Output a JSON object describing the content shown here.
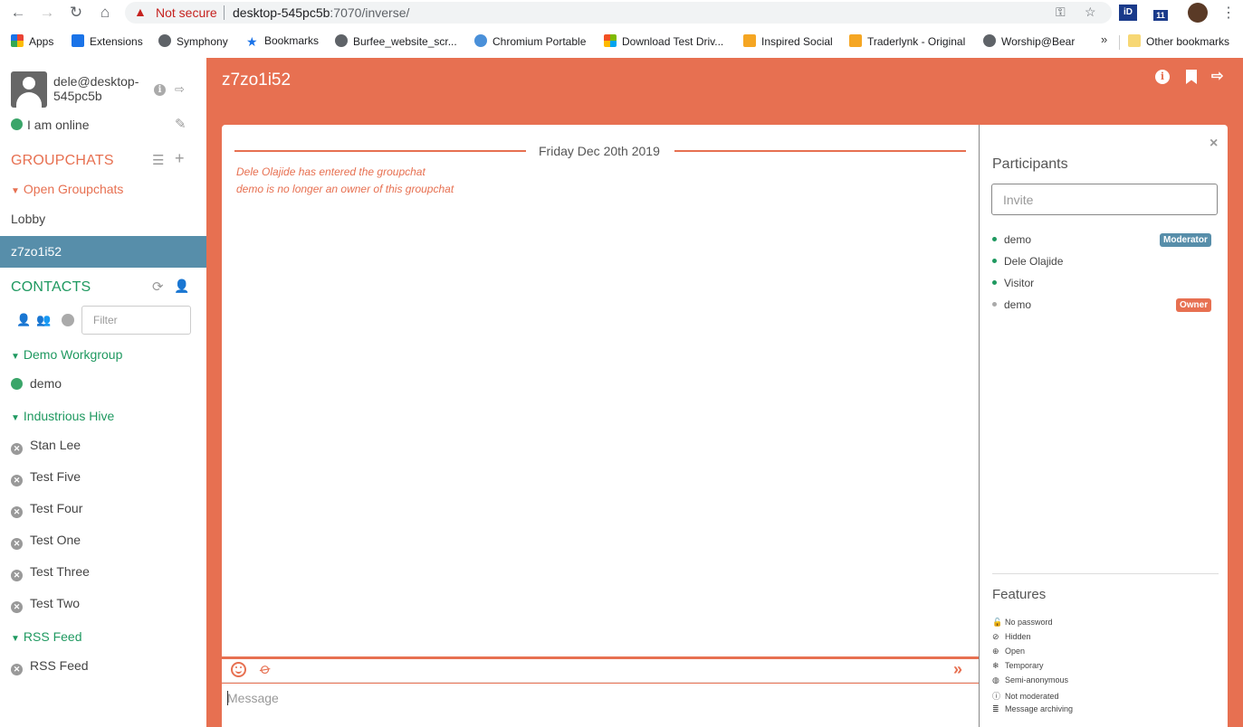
{
  "browser": {
    "not_secure": "Not secure",
    "url_host": "desktop-545pc5b",
    "url_path": ":7070/inverse/",
    "ext_badge": "11",
    "bookmarks": [
      {
        "label": "Apps",
        "color": "#ea4335"
      },
      {
        "label": "Extensions",
        "color": "#1a73e8"
      },
      {
        "label": "Symphony",
        "color": "#5f6368"
      },
      {
        "label": "Bookmarks",
        "color": "#1a73e8"
      },
      {
        "label": "Burfee_website_scr...",
        "color": "#5f6368"
      },
      {
        "label": "Chromium Portable",
        "color": "#4a90d9"
      },
      {
        "label": "Download Test Driv...",
        "color": "#f25022"
      },
      {
        "label": "Inspired Social",
        "color": "#f5a623"
      },
      {
        "label": "Traderlynk - Original",
        "color": "#f5a623"
      },
      {
        "label": "Worship@Bear",
        "color": "#5f6368"
      }
    ],
    "other_bookmarks": "Other bookmarks"
  },
  "sidebar": {
    "username": "dele@desktop-545pc5b",
    "status": "I am online",
    "groupchats_title": "GROUPCHATS",
    "open_groupchats": "Open Groupchats",
    "rooms": [
      {
        "name": "Lobby"
      },
      {
        "name": "z7zo1i52"
      }
    ],
    "contacts_title": "CONTACTS",
    "filter_placeholder": "Filter",
    "groups": [
      {
        "name": "Demo Workgroup",
        "contacts": [
          {
            "name": "demo",
            "online": true
          }
        ]
      },
      {
        "name": "Industrious Hive",
        "contacts": [
          {
            "name": "Stan Lee"
          },
          {
            "name": "Test Five"
          },
          {
            "name": "Test Four"
          },
          {
            "name": "Test One"
          },
          {
            "name": "Test Three"
          },
          {
            "name": "Test Two"
          }
        ]
      },
      {
        "name": "RSS Feed",
        "contacts": [
          {
            "name": "RSS Feed"
          }
        ]
      }
    ]
  },
  "chat": {
    "title": "z7zo1i52",
    "date": "Friday Dec 20th 2019",
    "messages": [
      "Dele Olajide has entered the groupchat",
      "demo is no longer an owner of this groupchat"
    ],
    "message_placeholder": "Message",
    "send_glyph": "»"
  },
  "participants": {
    "title": "Participants",
    "invite_placeholder": "Invite",
    "list": [
      {
        "name": "demo",
        "badge": "Moderator"
      },
      {
        "name": "Dele Olajide",
        "badge": ""
      },
      {
        "name": "Visitor",
        "badge": ""
      },
      {
        "name": "demo",
        "badge": "Owner"
      }
    ],
    "features_title": "Features",
    "features": [
      {
        "icon": "unlock-icon",
        "label": "No password"
      },
      {
        "icon": "eye-slash-icon",
        "label": "Hidden"
      },
      {
        "icon": "globe-icon",
        "label": "Open"
      },
      {
        "icon": "snowflake-icon",
        "label": "Temporary"
      },
      {
        "icon": "mask-icon",
        "label": "Semi-anonymous"
      },
      {
        "icon": "info-icon",
        "label": "Not moderated"
      },
      {
        "icon": "database-icon",
        "label": "Message archiving"
      }
    ]
  },
  "colors": {
    "accent": "#e77051",
    "contacts_green": "#1f9960",
    "active_room": "#578eaa",
    "online": "#3aa569"
  }
}
